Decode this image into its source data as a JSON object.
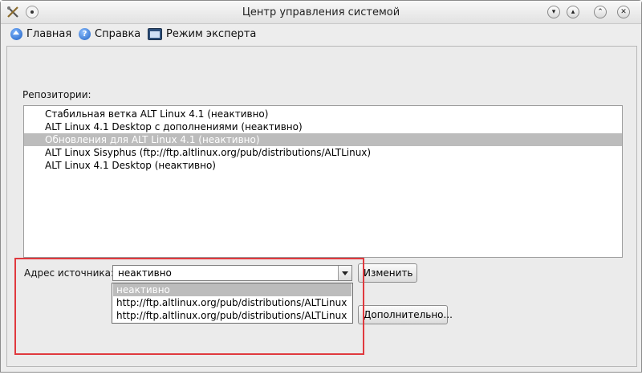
{
  "window": {
    "title": "Центр управления системой",
    "buttons": [
      "▾",
      "▴",
      "⌃",
      "✕"
    ]
  },
  "toolbar": {
    "home": "Главная",
    "help": "Справка",
    "expert": "Режим эксперта"
  },
  "repos": {
    "label": "Репозитории:",
    "items": [
      "Стабильная ветка ALT Linux 4.1 (неактивно)",
      "ALT Linux 4.1 Desktop с дополнениями (неактивно)",
      "Обновления для ALT Linux 4.1 (неактивно)",
      "ALT Linux Sisyphus (ftp://ftp.altlinux.org/pub/distributions/ALTLinux)",
      "ALT Linux 4.1 Desktop (неактивно)"
    ],
    "selected_index": 2
  },
  "source": {
    "label": "Адрес источника:",
    "value": "неактивно",
    "change_button": "Изменить",
    "more_button": "Дополнительно...",
    "options": [
      "неактивно",
      "http://ftp.altlinux.org/pub/distributions/ALTLinux",
      "http://ftp.altlinux.org/pub/distributions/ALTLinux"
    ],
    "highlight_color": "#e0393e"
  }
}
